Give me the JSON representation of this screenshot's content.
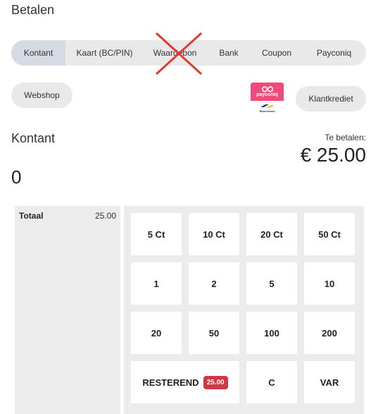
{
  "page": {
    "title": "Betalen"
  },
  "tabs": [
    {
      "label": "Kontant",
      "active": true
    },
    {
      "label": "Kaart (BC/PIN)",
      "active": false
    },
    {
      "label": "Waardebon",
      "active": false,
      "disabled": true
    },
    {
      "label": "Bank",
      "active": false
    },
    {
      "label": "Coupon",
      "active": false
    },
    {
      "label": "Payconiq",
      "active": false
    }
  ],
  "extra_buttons": {
    "webshop": "Webshop",
    "klantkrediet": "Klantkrediet"
  },
  "payconiq_logo": {
    "brand": "payconiq",
    "sub": "Bancontact"
  },
  "payment": {
    "method_title": "Kontant",
    "entered_amount": "0",
    "to_pay_label": "Te betalen:",
    "to_pay_amount": "€ 25.00"
  },
  "summary": {
    "label": "Totaal",
    "value": "25.00"
  },
  "keypad": {
    "row1": [
      "5 Ct",
      "10 Ct",
      "20 Ct",
      "50 Ct"
    ],
    "row2": [
      "1",
      "2",
      "5",
      "10"
    ],
    "row3": [
      "20",
      "50",
      "100",
      "200"
    ],
    "resterend_label": "RESTEREND",
    "resterend_badge": "25.00",
    "clear": "C",
    "var": "VAR"
  },
  "colors": {
    "badge": "#d13745",
    "cross": "#e03a2f",
    "payconiq_pink": "#f0497b",
    "active_tab": "#d6dbe3"
  }
}
